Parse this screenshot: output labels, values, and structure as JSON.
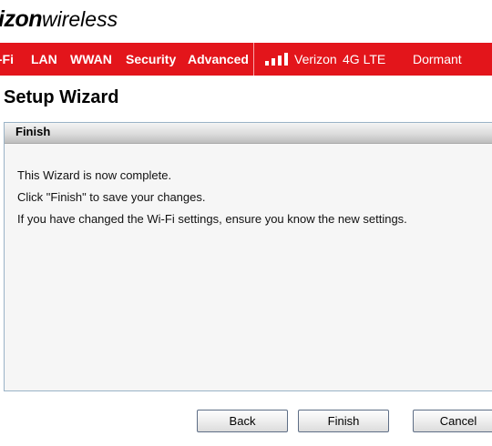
{
  "header": {
    "logo_brand": "izon",
    "logo_suffix": "wireless"
  },
  "nav": {
    "items": [
      {
        "label": "i-Fi"
      },
      {
        "label": "LAN"
      },
      {
        "label": "WWAN"
      },
      {
        "label": "Security"
      },
      {
        "label": "Advanced"
      }
    ],
    "carrier": "Verizon",
    "network_type": "4G LTE",
    "connection_status": "Dormant",
    "signal_bars": 4
  },
  "page": {
    "title": "Setup Wizard"
  },
  "panel": {
    "header": "Finish",
    "lines": [
      "This Wizard is now complete.",
      "Click \"Finish\" to save your changes.",
      "If you have changed the Wi-Fi settings, ensure you know the new settings."
    ]
  },
  "buttons": {
    "back": "Back",
    "finish": "Finish",
    "cancel": "Cancel"
  },
  "colors": {
    "nav_background": "#e3151b",
    "panel_border": "#9ab3c7"
  }
}
